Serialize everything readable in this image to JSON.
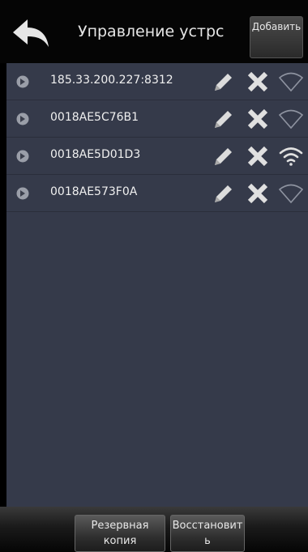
{
  "header": {
    "title": "Управление устрс",
    "add_label": "Добавить"
  },
  "devices": [
    {
      "name": "185.33.200.227:8312",
      "online": false
    },
    {
      "name": "0018AE5C76B1",
      "online": false
    },
    {
      "name": "0018AE5D01D3",
      "online": true
    },
    {
      "name": "0018AE573F0A",
      "online": false
    }
  ],
  "footer": {
    "backup_label": "Резервная копия",
    "restore_label": "Восстановить"
  },
  "colors": {
    "list_bg": "#353a4a",
    "icon": "#e0e0e0"
  },
  "icons": {
    "back": "back-arrow-icon",
    "bullet": "bullet-icon",
    "edit": "pencil-icon",
    "delete": "close-icon",
    "wifi_on": "wifi-icon",
    "wifi_off": "wifi-outline-icon"
  }
}
